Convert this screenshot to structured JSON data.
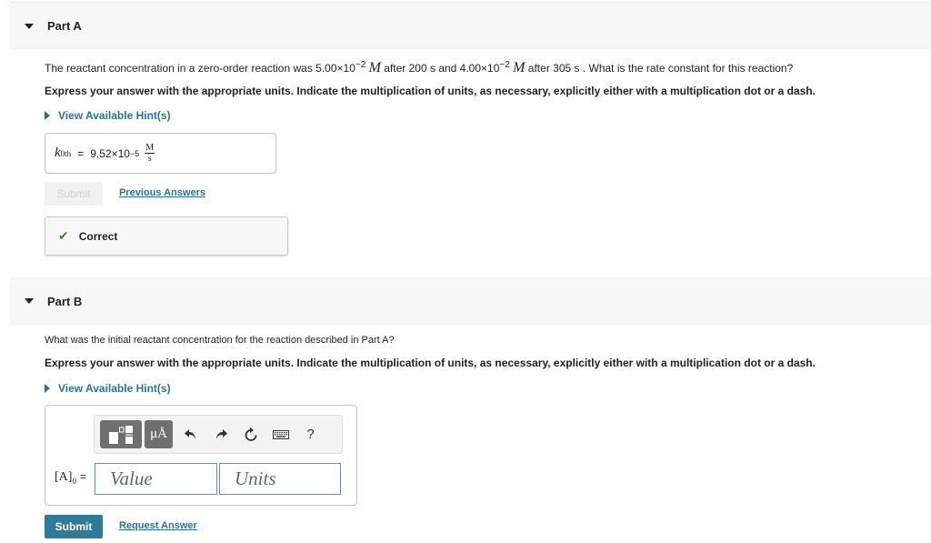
{
  "colors": {
    "link": "#2b7394",
    "submit_active": "#2f7a98",
    "correct_check": "#3b8a3e",
    "header_band": "#f7f7f7"
  },
  "part_a": {
    "title": "Part A",
    "question": {
      "pre": "The reactant concentration in a zero-order reaction was 5.00×10",
      "exp1": "−2",
      "unit1": "M",
      "mid": " after 200 s  and 4.00×10",
      "exp2": "−2",
      "unit2": "M",
      "post": " after 305 s . What is the rate constant for this reaction?"
    },
    "instructions": "Express your answer with the appropriate units. Indicate the multiplication of units, as necessary, explicitly either with a multiplication dot or a dash.",
    "hint_link": "View Available Hint(s)",
    "answer": {
      "variable": "k",
      "subscript": "0th",
      "equals": "=",
      "value": "9.52×10",
      "exponent": "−5",
      "unit_numerator": "M",
      "unit_denominator": "s"
    },
    "submit_label": "Submit",
    "previous_answers_link": "Previous Answers",
    "feedback": "Correct"
  },
  "part_b": {
    "title": "Part B",
    "question": "What was the initial reactant concentration for the reaction described in Part A?",
    "instructions": "Express your answer with the appropriate units. Indicate the multiplication of units, as necessary, explicitly either with a multiplication dot or a dash.",
    "hint_link": "View Available Hint(s)",
    "toolbar": {
      "templates_icon": "templates-icon",
      "units_label": "μÅ",
      "undo_icon": "undo-icon",
      "redo_icon": "redo-icon",
      "reset_icon": "reset-icon",
      "keyboard_icon": "keyboard-icon",
      "help_label": "?"
    },
    "answer_label": {
      "variable": "[A]",
      "subscript": "0",
      "equals": "="
    },
    "value_placeholder": "Value",
    "value_input": "",
    "units_placeholder": "Units",
    "units_input": "",
    "submit_label": "Submit",
    "request_answer_link": "Request Answer"
  }
}
